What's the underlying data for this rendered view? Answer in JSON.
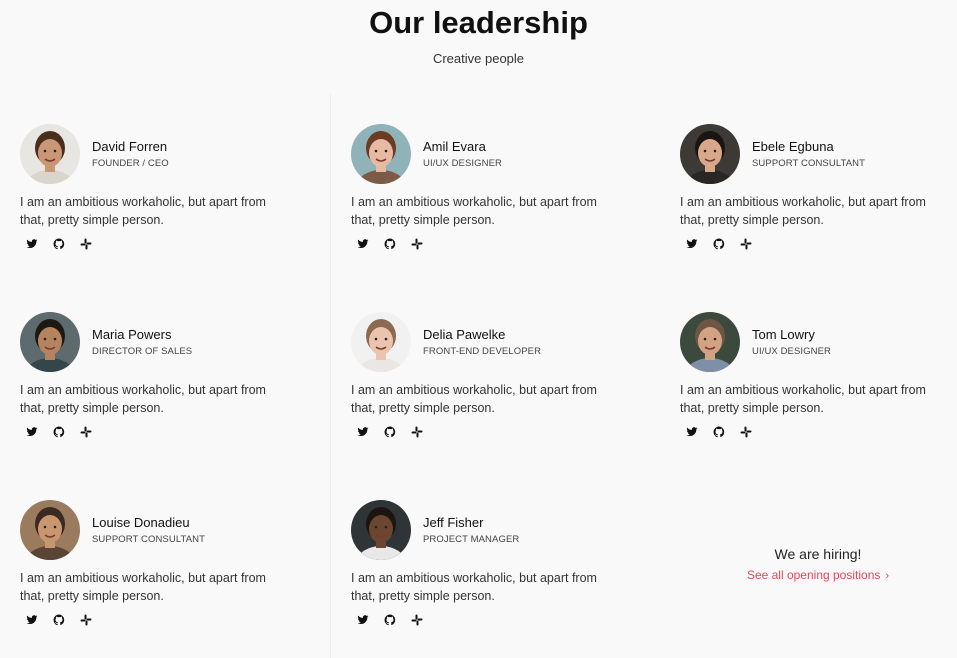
{
  "header": {
    "title": "Our leadership",
    "subtitle": "Creative people"
  },
  "members": [
    {
      "name": "David Forren",
      "role": "FOUNDER / CEO",
      "bio": "I am an ambitious workaholic, but apart from that, pretty simple person.",
      "skin": "#c99676",
      "hair": "#4a2e1c",
      "bg": "#e8e6e2",
      "shirt": "#d9d4cc"
    },
    {
      "name": "Amil Evara",
      "role": "UI/UX DESIGNER",
      "bio": "I am an ambitious workaholic, but apart from that, pretty simple person.",
      "skin": "#e8b9a3",
      "hair": "#6b3b24",
      "bg": "#8fb3b8",
      "shirt": "#7b5a47"
    },
    {
      "name": "Ebele Egbuna",
      "role": "SUPPORT CONSULTANT",
      "bio": "I am an ambitious workaholic, but apart from that, pretty simple person.",
      "skin": "#d8a88a",
      "hair": "#1a1412",
      "bg": "#3d3a36",
      "shirt": "#2a2624"
    },
    {
      "name": "Maria Powers",
      "role": "DIRECTOR OF SALES",
      "bio": "I am an ambitious workaholic, but apart from that, pretty simple person.",
      "skin": "#b5835e",
      "hair": "#1e1812",
      "bg": "#5d6a6e",
      "shirt": "#34464a"
    },
    {
      "name": "Delia Pawelke",
      "role": "FRONT-END DEVELOPER",
      "bio": "I am an ambitious workaholic, but apart from that, pretty simple person.",
      "skin": "#ecc4ad",
      "hair": "#8a6a52",
      "bg": "#f1f1f1",
      "shirt": "#e9e6e3"
    },
    {
      "name": "Tom Lowry",
      "role": "UI/UX DESIGNER",
      "bio": "I am an ambitious workaholic, but apart from that, pretty simple person.",
      "skin": "#d3a283",
      "hair": "#6e5544",
      "bg": "#3c4a3e",
      "shirt": "#7f8fa8"
    },
    {
      "name": "Louise Donadieu",
      "role": "SUPPORT CONSULTANT",
      "bio": "I am an ambitious workaholic, but apart from that, pretty simple person.",
      "skin": "#c8976f",
      "hair": "#3a2a22",
      "bg": "#9b7b5e",
      "shirt": "#5a4436"
    },
    {
      "name": "Jeff Fisher",
      "role": "PROJECT MANAGER",
      "bio": "I am an ambitious workaholic, but apart from that, pretty simple person.",
      "skin": "#6b4630",
      "hair": "#1c1410",
      "bg": "#2f3436",
      "shirt": "#e8e8e8"
    }
  ],
  "socials": [
    "twitter-icon",
    "github-icon",
    "slack-icon"
  ],
  "hiring": {
    "title": "We are hiring!",
    "link": "See all opening positions",
    "accent": "#e0475b"
  }
}
